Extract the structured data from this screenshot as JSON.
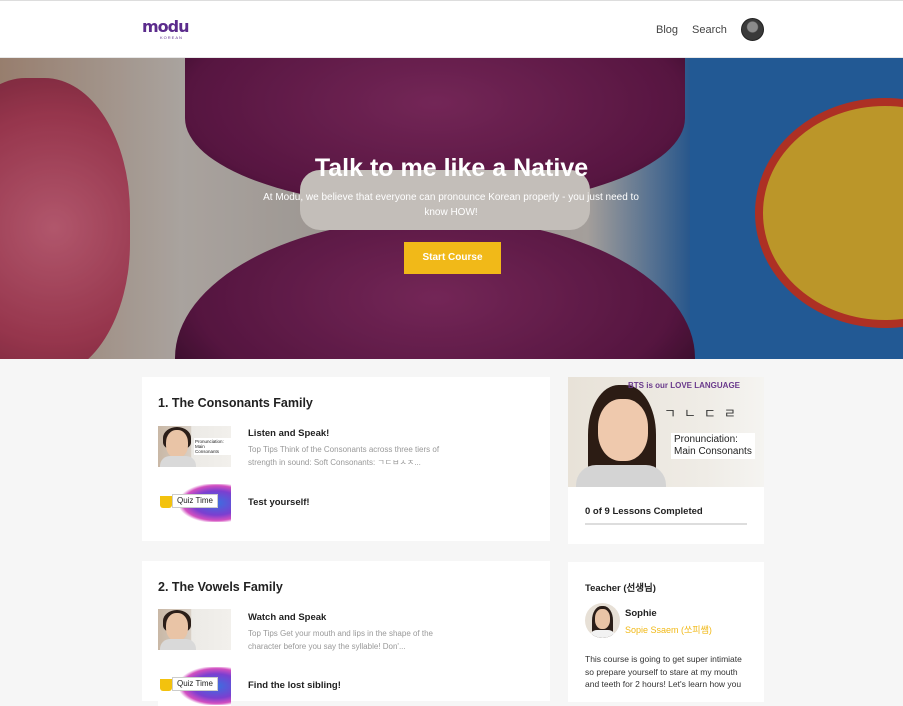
{
  "header": {
    "logo_text": "modu",
    "logo_sub": "KOREAN",
    "nav": [
      "Blog",
      "Search"
    ]
  },
  "hero": {
    "title": "Talk to me like a Native",
    "subtitle": "At Modu, we believe that everyone can pronounce Korean properly - you just need to know HOW!",
    "cta": "Start Course"
  },
  "sections": [
    {
      "title": "1. The Consonants Family",
      "lessons": [
        {
          "type": "video",
          "title": "Listen and Speak!",
          "description": "Top Tips Think of the Consonants across three tiers of strength in sound: Soft Consonants: ㄱㄷㅂㅅㅈ...",
          "thumb_tag": "Pronunciation: Main Consonants"
        },
        {
          "type": "quiz",
          "title": "Test yourself!",
          "thumb_tag": "Quiz Time"
        }
      ]
    },
    {
      "title": "2. The Vowels Family",
      "lessons": [
        {
          "type": "video",
          "title": "Watch and Speak",
          "description": "Top Tips Get your mouth and lips in the shape of the character before you say the syllable! Don'...",
          "thumb_tag": ""
        },
        {
          "type": "quiz",
          "title": "Find the lost sibling!",
          "thumb_tag": "Quiz Time"
        }
      ]
    }
  ],
  "sidebar": {
    "video": {
      "banner": "BTS is our LOVE LANGUAGE",
      "hangul": "ㄱㄴㄷㄹ",
      "tag_line1": "Pronunciation:",
      "tag_line2": "Main Consonants"
    },
    "progress": {
      "text": "0 of 9 Lessons Completed",
      "completed": 0,
      "total": 9
    },
    "teacher": {
      "heading": "Teacher (선생님)",
      "name": "Sophie",
      "alias": "Sopie Ssaem (쏘피쌤)",
      "bio": "This course is going to get super intimiate so prepare yourself to stare at my mouth and teeth for 2 hours! Let's learn how you"
    }
  },
  "colors": {
    "accent": "#f1b918",
    "brand": "#5b2b8c"
  }
}
